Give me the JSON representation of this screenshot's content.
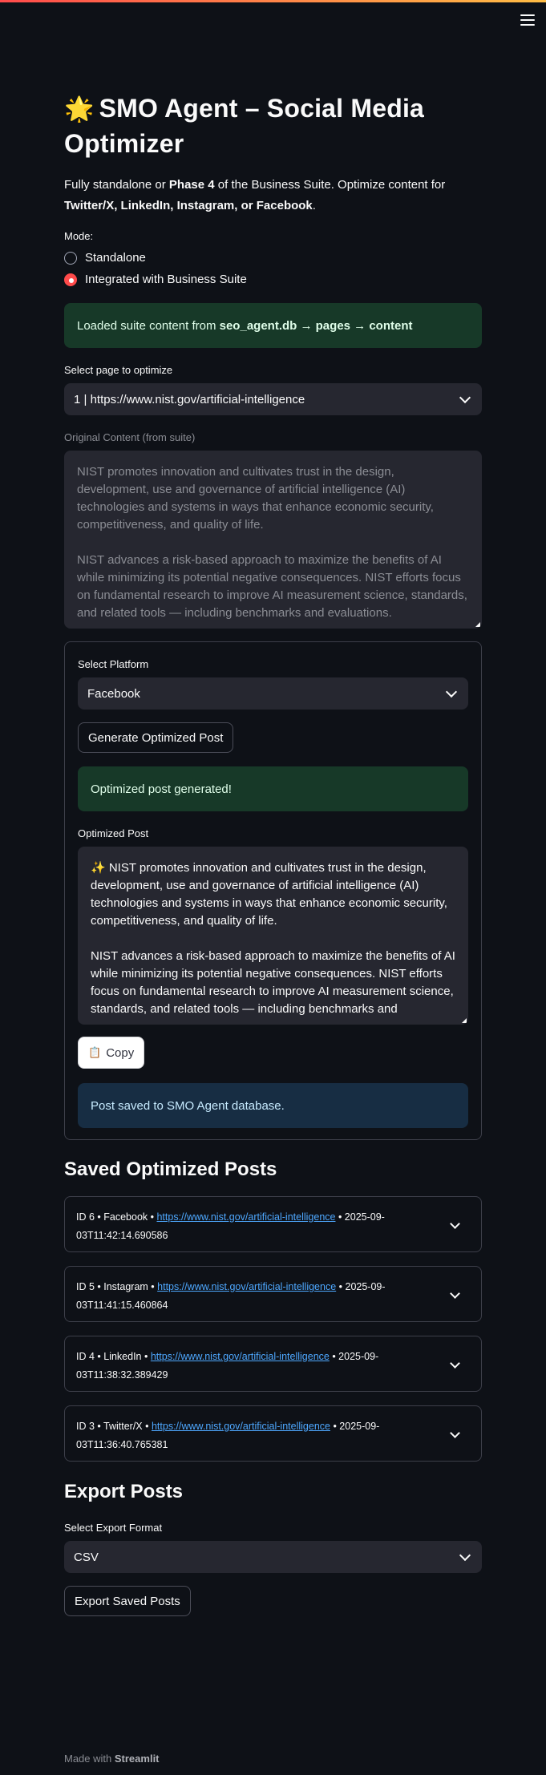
{
  "header": {
    "menu_icon": "hamburger-menu-icon"
  },
  "page": {
    "title_emoji": "🌟",
    "title": "SMO Agent – Social Media Optimizer",
    "intro": {
      "p1": "Fully standalone or ",
      "b1": "Phase 4",
      "p2": " of the Business Suite. Optimize content for ",
      "b2": "Twitter/X, LinkedIn, Instagram, or Facebook",
      "p3": "."
    }
  },
  "mode": {
    "label": "Mode:",
    "options": [
      "Standalone",
      "Integrated with Business Suite"
    ],
    "selected": "Integrated with Business Suite"
  },
  "load_notice": {
    "prefix": "Loaded suite content from ",
    "bold": "seo_agent.db → pages → content"
  },
  "page_select": {
    "label": "Select page to optimize",
    "value": "1 | https://www.nist.gov/artificial-intelligence"
  },
  "original_content": {
    "label": "Original Content (from suite)",
    "paragraphs": [
      "NIST promotes innovation and cultivates trust in the design, development, use and governance of artificial intelligence (AI) technologies and systems in ways that enhance economic security, competitiveness, and quality of life.",
      "NIST advances a risk-based approach to maximize the benefits of AI while minimizing its potential negative consequences. NIST efforts focus on fundamental research to improve AI measurement science, standards, and related tools — including benchmarks and evaluations."
    ]
  },
  "platform": {
    "label": "Select Platform",
    "value": "Facebook"
  },
  "generate_button": "Generate Optimized Post",
  "success_msg": "Optimized post generated!",
  "optimized": {
    "label": "Optimized Post",
    "paragraphs": [
      "✨ NIST promotes innovation and cultivates trust in the design, development, use and governance of artificial intelligence (AI) technologies and systems in ways that enhance economic security, competitiveness, and quality of life.",
      "NIST advances a risk-based approach to maximize the benefits of AI while minimizing its potential negative consequences. NIST efforts focus on fundamental research to improve AI measurement science, standards, and related tools — including benchmarks and"
    ]
  },
  "copy_button": {
    "icon": "clipboard-icon",
    "emoji": "📋",
    "label": "Copy"
  },
  "saved_msg": "Post saved to SMO Agent database.",
  "saved_posts": {
    "heading": "Saved Optimized Posts",
    "items": [
      {
        "prefix": "ID 6 • Facebook • ",
        "url": "https://www.nist.gov/artificial-intelligence",
        "suffix": " • 2025-09-03T11:42:14.690586"
      },
      {
        "prefix": "ID 5 • Instagram • ",
        "url": "https://www.nist.gov/artificial-intelligence",
        "suffix": " • 2025-09-03T11:41:15.460864"
      },
      {
        "prefix": "ID 4 • LinkedIn • ",
        "url": "https://www.nist.gov/artificial-intelligence",
        "suffix": " • 2025-09-03T11:38:32.389429"
      },
      {
        "prefix": "ID 3 • Twitter/X • ",
        "url": "https://www.nist.gov/artificial-intelligence",
        "suffix": " • 2025-09-03T11:36:40.765381"
      }
    ]
  },
  "export": {
    "heading": "Export Posts",
    "label": "Select Export Format",
    "value": "CSV",
    "button": "Export Saved Posts"
  },
  "footer": {
    "prefix": "Made with ",
    "brand": "Streamlit"
  },
  "colors": {
    "background": "#0e1117",
    "accent": "#ff4b4b",
    "success_bg": "#173928",
    "info_bg": "#172d43",
    "link": "#4ea8ff"
  }
}
